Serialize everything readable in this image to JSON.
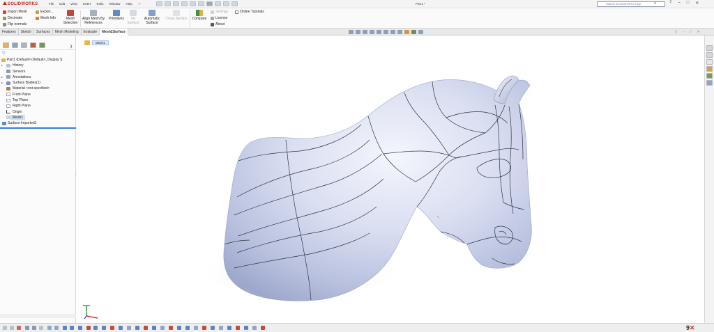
{
  "app": {
    "brand": "SOLIDWORKS",
    "document_title": "Part1 *",
    "menus": [
      "File",
      "Edit",
      "View",
      "Insert",
      "Tools",
      "Window",
      "Help"
    ],
    "search_placeholder": "Search SOLIDWORKS Help"
  },
  "commands": {
    "left_small": [
      "Import Mesh",
      "Decimate",
      "Flip normals"
    ],
    "mid_small": [
      "Export...",
      "Mesh Info"
    ],
    "mesh_selection": "Mesh Selection",
    "align_mesh": "Align Mesh By References",
    "primitives": "Primitives",
    "fit_surface": "Fit Surface",
    "automatic_surface": "Automatic Surface",
    "cross_section": "Cross Section",
    "compare": "Compare",
    "settings_small": [
      "Settings",
      "License",
      "About"
    ],
    "online_tutorials": "Online Tutorials"
  },
  "tabs": [
    {
      "label": "Features",
      "active": false
    },
    {
      "label": "Sketch",
      "active": false
    },
    {
      "label": "Surfaces",
      "active": false
    },
    {
      "label": "Mesh Modeling",
      "active": false
    },
    {
      "label": "Evaluate",
      "active": false
    },
    {
      "label": "Mesh2Surface",
      "active": true
    }
  ],
  "feature_tree": {
    "root": "Part1 (Default<<Default>_Display S",
    "items": [
      {
        "label": "History",
        "icon": "history-icon",
        "expandable": true
      },
      {
        "label": "Sensors",
        "icon": "sensors-icon",
        "expandable": false
      },
      {
        "label": "Annotations",
        "icon": "annotations-icon",
        "expandable": true
      },
      {
        "label": "Surface Bodies(1)",
        "icon": "surface-bodies-icon",
        "expandable": true
      },
      {
        "label": "Material <not specified>",
        "icon": "material-icon",
        "expandable": false
      },
      {
        "label": "Front Plane",
        "icon": "plane-icon",
        "expandable": false
      },
      {
        "label": "Top Plane",
        "icon": "plane-icon",
        "expandable": false
      },
      {
        "label": "Right Plane",
        "icon": "plane-icon",
        "expandable": false
      },
      {
        "label": "Origin",
        "icon": "origin-icon",
        "expandable": false
      },
      {
        "label": "Mesh1",
        "icon": "mesh-icon",
        "expandable": false,
        "selected": true
      },
      {
        "label": "Surface-Imported1",
        "icon": "surface-imported-icon",
        "expandable": false
      }
    ]
  },
  "breadcrumb": {
    "item": "Mesh1"
  },
  "colors": {
    "brand_red": "#d7261e",
    "selection_blue": "#3b7dd8",
    "model_surface": "#c7cde8"
  }
}
